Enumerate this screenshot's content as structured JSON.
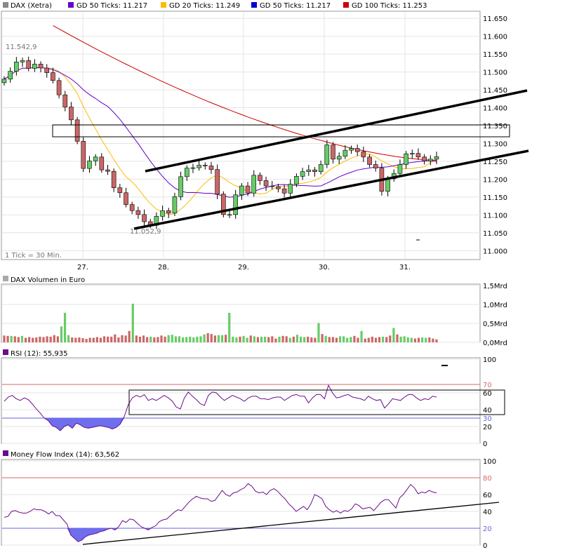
{
  "colors": {
    "sma50": "#6600cc",
    "sma20": "#ffbb00",
    "sma50_blue": "#0000cc",
    "sma100": "#cc0000",
    "up": "#66cc66",
    "down": "#cc6666",
    "rsi_line": "#6a0c8c",
    "mfi_line": "#6a0c8c",
    "fill_low": "#6666ee",
    "ref_red": "#dd6666",
    "ref_blue": "#6666dd"
  },
  "chart_data": [
    {
      "type": "candlestick",
      "legend": [
        {
          "label": "DAX (Xetra)",
          "color": "#888888"
        },
        {
          "label": "GD 50 Ticks: 11.217",
          "color": "#6600cc"
        },
        {
          "label": "GD 20 Ticks: 11.249",
          "color": "#ffbb00"
        },
        {
          "label": "GD 50 Ticks: 11.217",
          "color": "#0000cc"
        },
        {
          "label": "GD 100 Ticks: 11.253",
          "color": "#cc0000"
        }
      ],
      "x_tick_labels": [
        "27.",
        "28.",
        "29.",
        "30.",
        "31."
      ],
      "y_tick_labels": [
        "11.650",
        "11.600",
        "11.550",
        "11.500",
        "11.450",
        "11.400",
        "11.350",
        "11.300",
        "11.250",
        "11.200",
        "11.150",
        "11.100",
        "11.050",
        "11.000"
      ],
      "ylim": [
        10975,
        11670
      ],
      "annotations": {
        "high": "11.542,9",
        "low": "11.052,9",
        "tick_note": "1 Tick = 30 Min."
      },
      "close": [
        11480,
        11502,
        11528,
        11532,
        11510,
        11522,
        11511,
        11498,
        11476,
        11436,
        11402,
        11366,
        11306,
        11230,
        11251,
        11262,
        11226,
        11222,
        11176,
        11162,
        11129,
        11112,
        11101,
        11081,
        11071,
        11096,
        11112,
        11105,
        11151,
        11207,
        11231,
        11232,
        11239,
        11237,
        11227,
        11158,
        11101,
        11101,
        11156,
        11181,
        11161,
        11211,
        11196,
        11181,
        11179,
        11173,
        11161,
        11186,
        11208,
        11221,
        11226,
        11221,
        11241,
        11296,
        11256,
        11264,
        11281,
        11286,
        11277,
        11262,
        11241,
        11231,
        11166,
        11201,
        11216,
        11241,
        11271,
        11272,
        11262,
        11251,
        11256,
        11263
      ],
      "ma_gd20_desc": "descending from 11.520 to 11.160 around 28., then rising to 11.249",
      "ma_gd50_desc": "descending from 11.542 to 11.180 around 30., then to 11.217",
      "ma_gd100_desc": "descending from 11.630 to 11.253"
    },
    {
      "type": "bar",
      "title": "DAX Volumen in Euro",
      "y_tick_labels": [
        "1,5Mrd",
        "1,0Mrd",
        "0,5Mrd",
        "0,0Mrd"
      ],
      "ylim": [
        0,
        1.5
      ],
      "values": [
        0.18,
        0.17,
        0.17,
        0.16,
        0.14,
        0.17,
        0.12,
        0.14,
        0.12,
        0.13,
        0.15,
        0.14,
        0.16,
        0.15,
        0.19,
        0.16,
        0.42,
        0.78,
        0.19,
        0.13,
        0.12,
        0.13,
        0.11,
        0.09,
        0.12,
        0.12,
        0.14,
        0.12,
        0.16,
        0.15,
        0.15,
        0.21,
        0.13,
        0.19,
        0.18,
        0.3,
        1.02,
        0.18,
        0.15,
        0.18,
        0.14,
        0.15,
        0.13,
        0.14,
        0.18,
        0.15,
        0.19,
        0.2,
        0.16,
        0.16,
        0.13,
        0.14,
        0.15,
        0.13,
        0.15,
        0.16,
        0.21,
        0.24,
        0.22,
        0.18,
        0.19,
        0.19,
        0.2,
        0.78,
        0.15,
        0.13,
        0.15,
        0.17,
        0.12,
        0.18,
        0.16,
        0.14,
        0.15,
        0.15,
        0.14,
        0.16,
        0.1,
        0.15,
        0.17,
        0.16,
        0.12,
        0.15,
        0.2,
        0.15,
        0.14,
        0.15,
        0.13,
        0.12,
        0.51,
        0.22,
        0.17,
        0.14,
        0.14,
        0.12,
        0.16,
        0.16,
        0.12,
        0.14,
        0.17,
        0.12,
        0.3,
        0.1,
        0.12,
        0.15,
        0.12,
        0.14,
        0.15,
        0.14,
        0.18,
        0.38,
        0.21,
        0.15,
        0.16,
        0.13,
        0.12,
        0.1,
        0.12,
        0.13,
        0.12,
        0.13,
        0.1,
        0.08
      ],
      "up": [
        0,
        0,
        1,
        0,
        0,
        1,
        0,
        0,
        0,
        0,
        0,
        0,
        0,
        0,
        0,
        0,
        1,
        1,
        1,
        0,
        0,
        0,
        0,
        0,
        0,
        0,
        0,
        0,
        0,
        0,
        0,
        0,
        0,
        0,
        0,
        0,
        1,
        0,
        0,
        0,
        0,
        1,
        0,
        0,
        0,
        0,
        1,
        1,
        1,
        1,
        1,
        1,
        1,
        1,
        1,
        1,
        1,
        0,
        0,
        0,
        1,
        1,
        0,
        1,
        1,
        1,
        0,
        1,
        1,
        0,
        1,
        0,
        1,
        1,
        0,
        0,
        0,
        1,
        0,
        0,
        1,
        0,
        1,
        1,
        1,
        0,
        0,
        0,
        1,
        0,
        1,
        0,
        0,
        0,
        1,
        1,
        1,
        1,
        0,
        0,
        1,
        0,
        0,
        0,
        0,
        0,
        1,
        0,
        0,
        1,
        0,
        1,
        1,
        1,
        1,
        0,
        0,
        1,
        1,
        0,
        0,
        0
      ]
    },
    {
      "type": "line",
      "title": "RSI (12): 55,935",
      "y_tick_labels": [
        "100",
        "70",
        "60",
        "40",
        "30",
        "20",
        "0"
      ],
      "ylim": [
        0,
        100
      ],
      "ref_lines": [
        70,
        30
      ],
      "values": [
        50,
        55,
        57,
        53,
        51,
        54,
        52,
        47,
        41,
        36,
        30,
        27,
        21,
        19,
        15,
        20,
        22,
        18,
        24,
        22,
        19,
        18,
        19,
        20,
        21,
        20,
        19,
        17,
        19,
        23,
        32,
        46,
        54,
        57,
        55,
        58,
        51,
        53,
        51,
        54,
        57,
        54,
        50,
        43,
        41,
        54,
        61,
        56,
        52,
        47,
        45,
        57,
        61,
        60,
        55,
        51,
        54,
        57,
        55,
        53,
        50,
        54,
        56,
        56,
        53,
        53,
        52,
        54,
        55,
        55,
        51,
        54,
        57,
        58,
        56,
        56,
        48,
        54,
        58,
        58,
        53,
        69,
        60,
        54,
        55,
        57,
        58,
        55,
        54,
        53,
        51,
        56,
        53,
        51,
        52,
        42,
        47,
        53,
        52,
        51,
        55,
        58,
        58,
        54,
        51,
        53,
        52,
        56,
        55
      ],
      "box_values": [
        35,
        62
      ]
    },
    {
      "type": "line",
      "title": "Money Flow Index (14): 63,562",
      "y_tick_labels": [
        "100",
        "80",
        "60",
        "40",
        "20",
        "0"
      ],
      "ylim": [
        0,
        100
      ],
      "ref_lines": [
        80,
        20
      ],
      "values": [
        33,
        34,
        40,
        41,
        39,
        38,
        38,
        40,
        43,
        42,
        42,
        40,
        37,
        40,
        35,
        35,
        30,
        25,
        12,
        8,
        4,
        6,
        10,
        12,
        13,
        14,
        16,
        17,
        19,
        20,
        18,
        22,
        29,
        27,
        31,
        30,
        26,
        22,
        20,
        18,
        21,
        23,
        28,
        30,
        31,
        35,
        39,
        42,
        41,
        46,
        51,
        55,
        58,
        56,
        55,
        55,
        52,
        53,
        59,
        65,
        60,
        58,
        62,
        63,
        66,
        68,
        73,
        70,
        64,
        62,
        63,
        60,
        65,
        67,
        64,
        59,
        55,
        49,
        45,
        40,
        43,
        46,
        42,
        49,
        60,
        58,
        55,
        46,
        42,
        39,
        41,
        38,
        41,
        40,
        43,
        49,
        47,
        43,
        44,
        45,
        41,
        46,
        51,
        54,
        54,
        49,
        44,
        56,
        60,
        66,
        72,
        68,
        61,
        63,
        62,
        65,
        63,
        62
      ],
      "trend_line": [
        [
          0,
          -2
        ],
        [
          1,
          48
        ]
      ]
    }
  ]
}
